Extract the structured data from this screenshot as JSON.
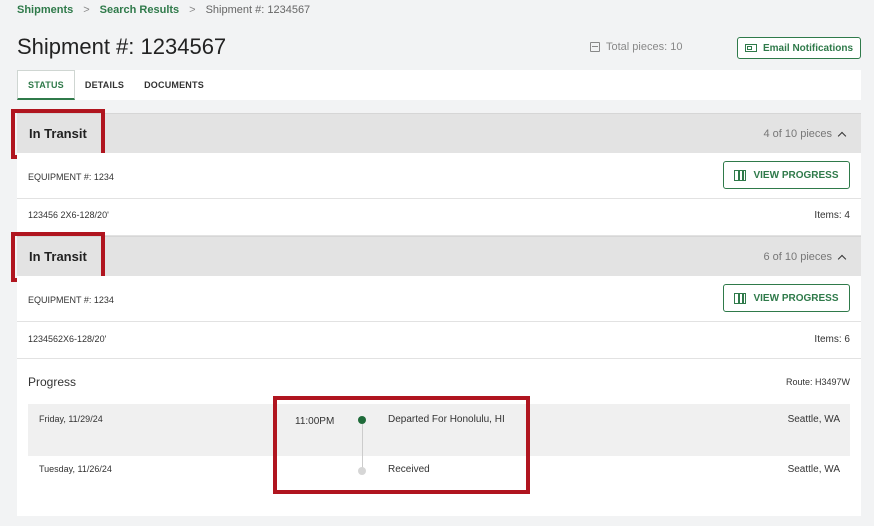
{
  "breadcrumb": {
    "items": [
      "Shipments",
      "Search Results"
    ],
    "current": "Shipment #: 1234567",
    "separator": ">"
  },
  "header": {
    "title": "Shipment #: 1234567",
    "total_pieces": "Total pieces: 10",
    "email_button": "Email Notifications"
  },
  "tabs": [
    {
      "label": "STATUS",
      "active": true
    },
    {
      "label": "DETAILS",
      "active": false
    },
    {
      "label": "DOCUMENTS",
      "active": false
    }
  ],
  "groups": [
    {
      "status": "In Transit",
      "pieces": "4 of 10 pieces",
      "equipment": "EQUIPMENT #: 1234",
      "view_button": "VIEW PROGRESS",
      "item_desc": "123456 2X6-128/20'",
      "items": "Items: 4"
    },
    {
      "status": "In Transit",
      "pieces": "6 of 10 pieces",
      "equipment": "EQUIPMENT #: 1234",
      "view_button": "VIEW PROGRESS",
      "item_desc": "1234562X6-128/20'",
      "items": "Items: 6"
    }
  ],
  "progress": {
    "title": "Progress",
    "route": "Route: H3497W",
    "events": [
      {
        "date": "Friday, 11/29/24",
        "time": "11:00PM",
        "event": "Departed For Honolulu, HI",
        "location": "Seattle, WA",
        "current": true
      },
      {
        "date": "Tuesday, 11/26/24",
        "time": "",
        "event": "Received",
        "location": "Seattle, WA",
        "current": false
      }
    ]
  },
  "colors": {
    "accent": "#2f7a4a",
    "highlight": "#b0151f",
    "current_dot": "#1f6b3a",
    "past_dot": "#d6d6d6"
  }
}
